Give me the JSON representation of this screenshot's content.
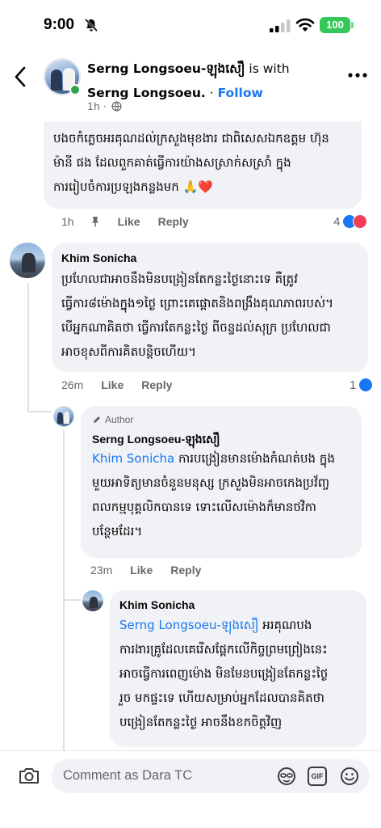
{
  "status_bar": {
    "time": "9:00",
    "battery": "100"
  },
  "header": {
    "author": "Serng Longsoeu-ឡុងសឿ",
    "with_text": " is with ",
    "with_name": "Serng Longsoeu.",
    "separator": " · ",
    "follow": "Follow",
    "time": "1h",
    "meta_sep": " · "
  },
  "comments": [
    {
      "name": "",
      "lines": [
        "បងចកំភ្លេចអរគុណដល់ក្រសួងមុខងារ ជាពិសេសឯកឧត្តម ហ៊ុន",
        "ម៉ានី ផង ដែលពួកគាត់ធ្វើការយ៉ាងសស្រាក់សស្រាំ ក្នុង",
        "ការរៀបចំការប្រឡងកន្លងមក 🙏❤️"
      ],
      "time": "1h",
      "like": "Like",
      "reply": "Reply",
      "reactions": "4"
    },
    {
      "name": "Khim Sonicha",
      "lines": [
        "ប្រហែលជាអាចនឹងមិនបង្រៀនតែកន្លះថ្ងៃនោះទេ គឺត្រូវ",
        "ធ្វើការ៨ម៉ោងក្នុង១ថ្ងៃ ព្រោះគេផ្តោតនិងពង្រឹងគុណភាពរបស់។",
        "បើអ្នកណាគិតថា ធ្វើការតែកន្លះថ្ងៃ ពីចន្ទដល់សុក្រ ប្រហែលជា",
        "អាចខុសពីការគិតបន្តិចហើយ។"
      ],
      "time": "26m",
      "like": "Like",
      "reply": "Reply",
      "reactions": "1"
    },
    {
      "author_tag": "Author",
      "name": "Serng Longsoeu-ឡុងសឿ",
      "mention": "Khim Sonicha",
      "first_rest": " ការបង្រៀនមានម៉ោងកំណត់បង ក្នុង",
      "lines": [
        "មួយអាទិត្យមានចំនួនមនុស្ស ក្រសួងមិនអាចកេងប្រវ័ញ្ច",
        "ពលកម្មបុគ្គលិកបានទេ ទោះលើសម៉ោងក៏មានថវិកា",
        "បន្ថែមដែរ។"
      ],
      "time": "23m",
      "like": "Like",
      "reply": "Reply"
    },
    {
      "name": "Khim Sonicha",
      "mention": "Serng Longsoeu-ឡុងសឿ",
      "first_rest": " អរគុណបង",
      "lines": [
        "ការងារគ្រូដែលគេរើសផ្តែកលើកិច្ចព្រមព្រៀងនេះ",
        "អាចធ្វើការពេញម៉ោង មិនមែនបង្រៀនតែកន្លះថ្ងៃ",
        "រួច មកផ្ទះទេ ហើយសម្រាប់អ្នកដែលបានគិតថា",
        "បង្រៀនតែកន្លះថ្ងៃ អាចនឹងខកចិត្តវិញ"
      ]
    }
  ],
  "composer": {
    "placeholder": "Comment as Dara TC",
    "gif": "GIF"
  },
  "colors": {
    "accent": "#1877f2",
    "bubble": "#f0f2f5",
    "muted": "#65676b",
    "online": "#31a24c",
    "love": "#f33e58"
  },
  "icons": [
    "muted-bell-icon",
    "signal-icon",
    "wifi-icon",
    "back-chevron-icon",
    "more-dots-icon",
    "globe-icon",
    "pin-icon",
    "like-reaction-icon",
    "love-reaction-icon",
    "pencil-icon",
    "camera-icon",
    "avatar-sticker-icon",
    "gif-icon",
    "emoji-icon"
  ]
}
